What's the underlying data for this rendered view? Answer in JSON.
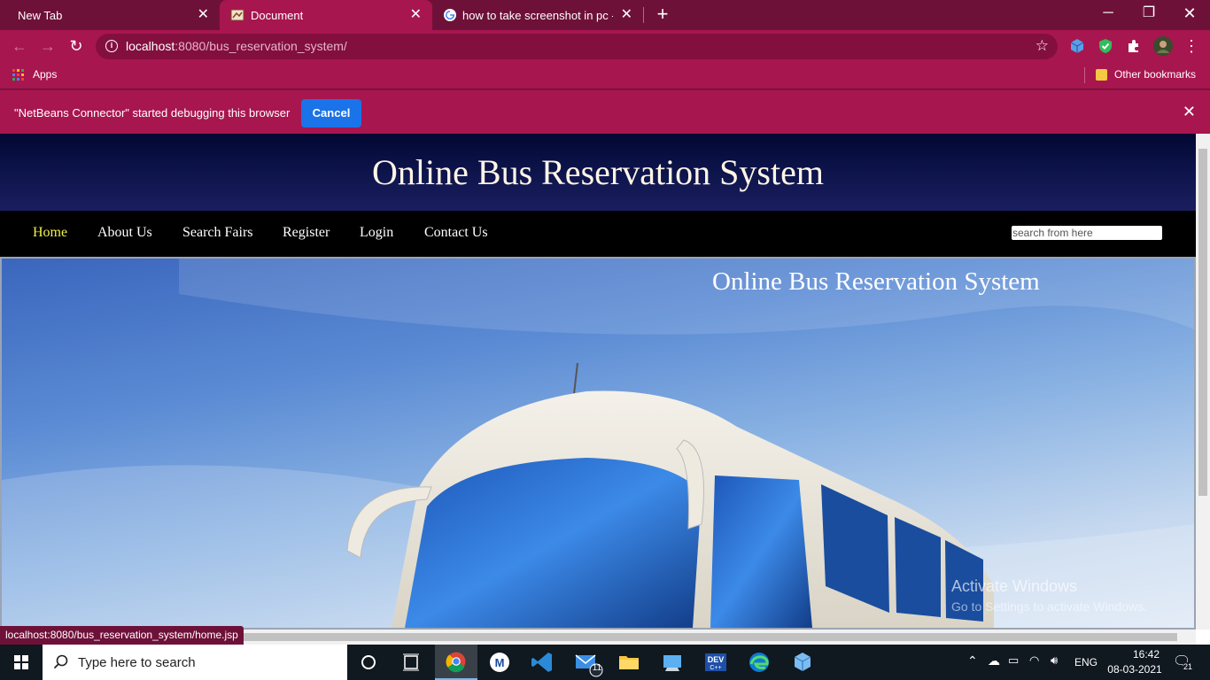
{
  "browser": {
    "tabs": [
      {
        "title": "New Tab",
        "active": false
      },
      {
        "title": "Document",
        "active": true
      },
      {
        "title": "how to take screenshot in pc - Go",
        "active": false
      }
    ],
    "url_host": "localhost",
    "url_rest": ":8080/bus_reservation_system/",
    "bookmarks": {
      "apps_label": "Apps",
      "other_label": "Other bookmarks"
    },
    "infobar": {
      "text": "\"NetBeans Connector\" started debugging this browser",
      "cancel_label": "Cancel"
    },
    "status_url": "localhost:8080/bus_reservation_system/home.jsp",
    "colors": {
      "frame": "#6e1138",
      "toolbar": "#a8164f",
      "button": "#1a73e8"
    }
  },
  "site": {
    "title": "Online Bus Reservation System",
    "nav": [
      "Home",
      "About Us",
      "Search Fairs",
      "Register",
      "Login",
      "Contact Us"
    ],
    "search_placeholder": "search from here",
    "hero_title": "Online Bus Reservation System",
    "colors": {
      "active_nav": "#f2f24a",
      "header_bg": "#0b1247"
    }
  },
  "watermark": {
    "title": "Activate Windows",
    "subtitle": "Go to Settings to activate Windows."
  },
  "taskbar": {
    "search_placeholder": "Type here to search",
    "mail_badge": "11",
    "language": "ENG",
    "time": "16:42",
    "date": "08-03-2021",
    "notification_count": "21"
  }
}
